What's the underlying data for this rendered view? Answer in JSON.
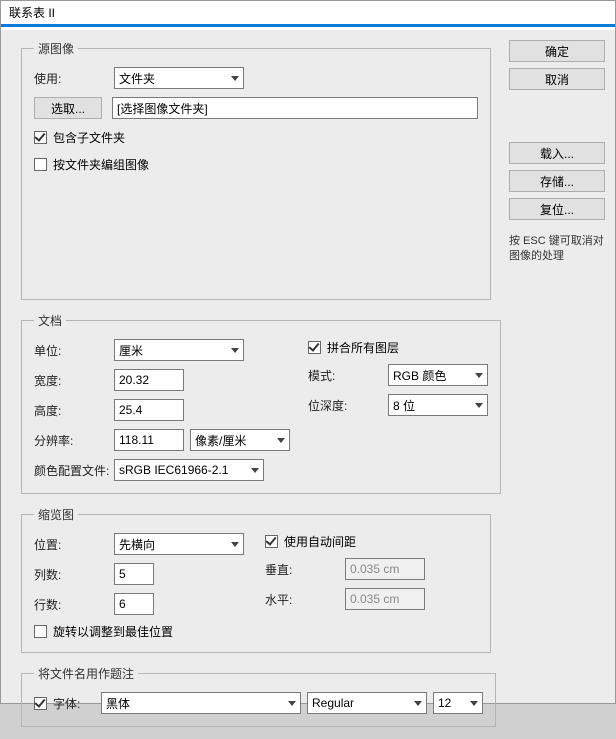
{
  "title": "联系表 II",
  "side": {
    "ok": "确定",
    "cancel": "取消",
    "load": "载入...",
    "save": "存储...",
    "reset": "复位...",
    "hint": "按 ESC 键可取消对图像的处理"
  },
  "src": {
    "legend": "源图像",
    "use_label": "使用:",
    "use_value": "文件夹",
    "choose_btn": "选取...",
    "folder_text": "[选择图像文件夹]",
    "include_sub": "包含子文件夹",
    "group_by_folder": "按文件夹编组图像"
  },
  "doc": {
    "legend": "文档",
    "unit_label": "单位:",
    "unit_value": "厘米",
    "width_label": "宽度:",
    "width_value": "20.32",
    "height_label": "高度:",
    "height_value": "25.4",
    "res_label": "分辨率:",
    "res_value": "118.11",
    "res_unit": "像素/厘米",
    "profile_label": "颜色配置文件:",
    "profile_value": "sRGB IEC61966-2.1",
    "flatten": "拼合所有图层",
    "mode_label": "模式:",
    "mode_value": "RGB 颜色",
    "depth_label": "位深度:",
    "depth_value": "8 位"
  },
  "thumb": {
    "legend": "缩览图",
    "place_label": "位置:",
    "place_value": "先横向",
    "cols_label": "列数:",
    "cols_value": "5",
    "rows_label": "行数:",
    "rows_value": "6",
    "rotate": "旋转以调整到最佳位置",
    "auto": "使用自动间距",
    "v_label": "垂直:",
    "v_value": "0.035 cm",
    "h_label": "水平:",
    "h_value": "0.035 cm"
  },
  "cap": {
    "legend": "将文件名用作题注",
    "font_label": "字体:",
    "font_value": "黑体",
    "style_value": "Regular",
    "size_value": "12"
  }
}
